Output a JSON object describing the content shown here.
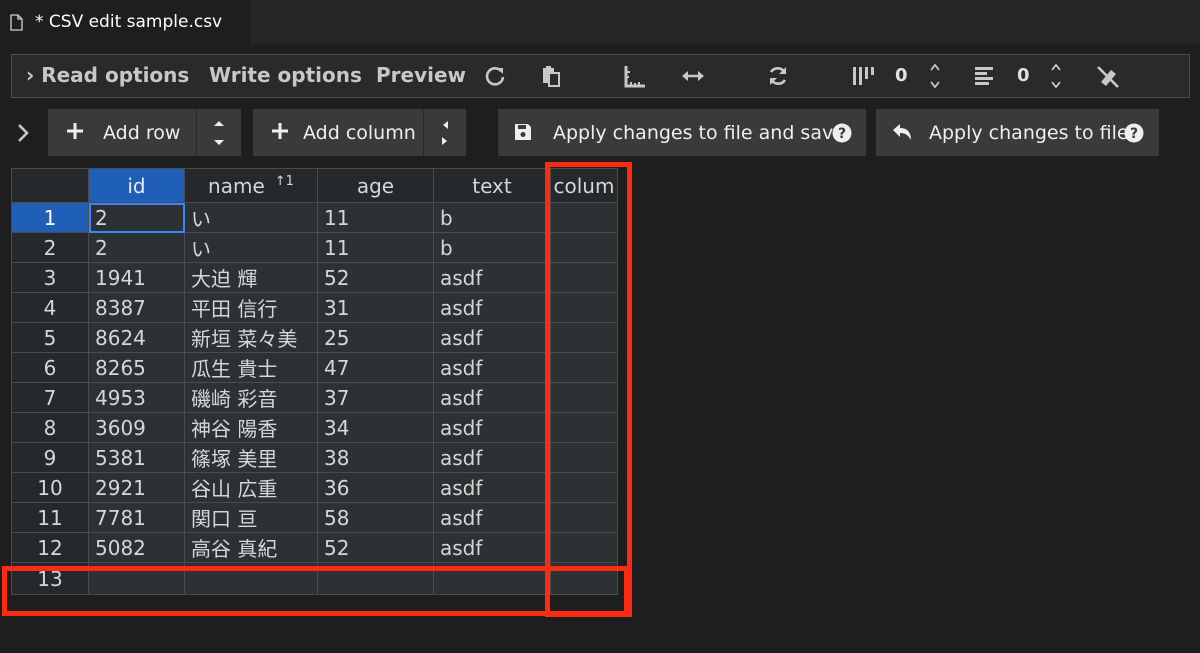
{
  "tab": {
    "title": "* CSV edit sample.csv"
  },
  "options_bar": {
    "read_options": "Read options",
    "write_options": "Write options",
    "preview": "Preview",
    "fixed_columns_value": "0",
    "fixed_rows_value": "0"
  },
  "buttons": {
    "add_row": "Add row",
    "add_column": "Add column",
    "apply_and_save": "Apply changes to file and save",
    "apply": "Apply changes to file"
  },
  "table": {
    "headers": [
      "id",
      "name",
      "age",
      "text",
      "colum"
    ],
    "rows": [
      {
        "num": "1",
        "cells": [
          "2",
          "い",
          "11",
          "b",
          ""
        ]
      },
      {
        "num": "2",
        "cells": [
          "2",
          "い",
          "11",
          "b",
          ""
        ]
      },
      {
        "num": "3",
        "cells": [
          "1941",
          "大迫 輝",
          "52",
          "asdf",
          ""
        ]
      },
      {
        "num": "4",
        "cells": [
          "8387",
          "平田 信行",
          "31",
          "asdf",
          ""
        ]
      },
      {
        "num": "5",
        "cells": [
          "8624",
          "新垣 菜々美",
          "25",
          "asdf",
          ""
        ]
      },
      {
        "num": "6",
        "cells": [
          "8265",
          "瓜生 貴士",
          "47",
          "asdf",
          ""
        ]
      },
      {
        "num": "7",
        "cells": [
          "4953",
          "磯崎 彩音",
          "37",
          "asdf",
          ""
        ]
      },
      {
        "num": "8",
        "cells": [
          "3609",
          "神谷 陽香",
          "34",
          "asdf",
          ""
        ]
      },
      {
        "num": "9",
        "cells": [
          "5381",
          "篠塚 美里",
          "38",
          "asdf",
          ""
        ]
      },
      {
        "num": "10",
        "cells": [
          "2921",
          "谷山 広重",
          "36",
          "asdf",
          ""
        ]
      },
      {
        "num": "11",
        "cells": [
          "7781",
          "関口 亘",
          "58",
          "asdf",
          ""
        ]
      },
      {
        "num": "12",
        "cells": [
          "5082",
          "高谷 真紀",
          "52",
          "asdf",
          ""
        ]
      },
      {
        "num": "13",
        "cells": [
          "",
          "",
          "",
          "",
          ""
        ]
      }
    ]
  },
  "colors": {
    "accent": "#1f5fb8",
    "annotation": "#ff2a12"
  }
}
